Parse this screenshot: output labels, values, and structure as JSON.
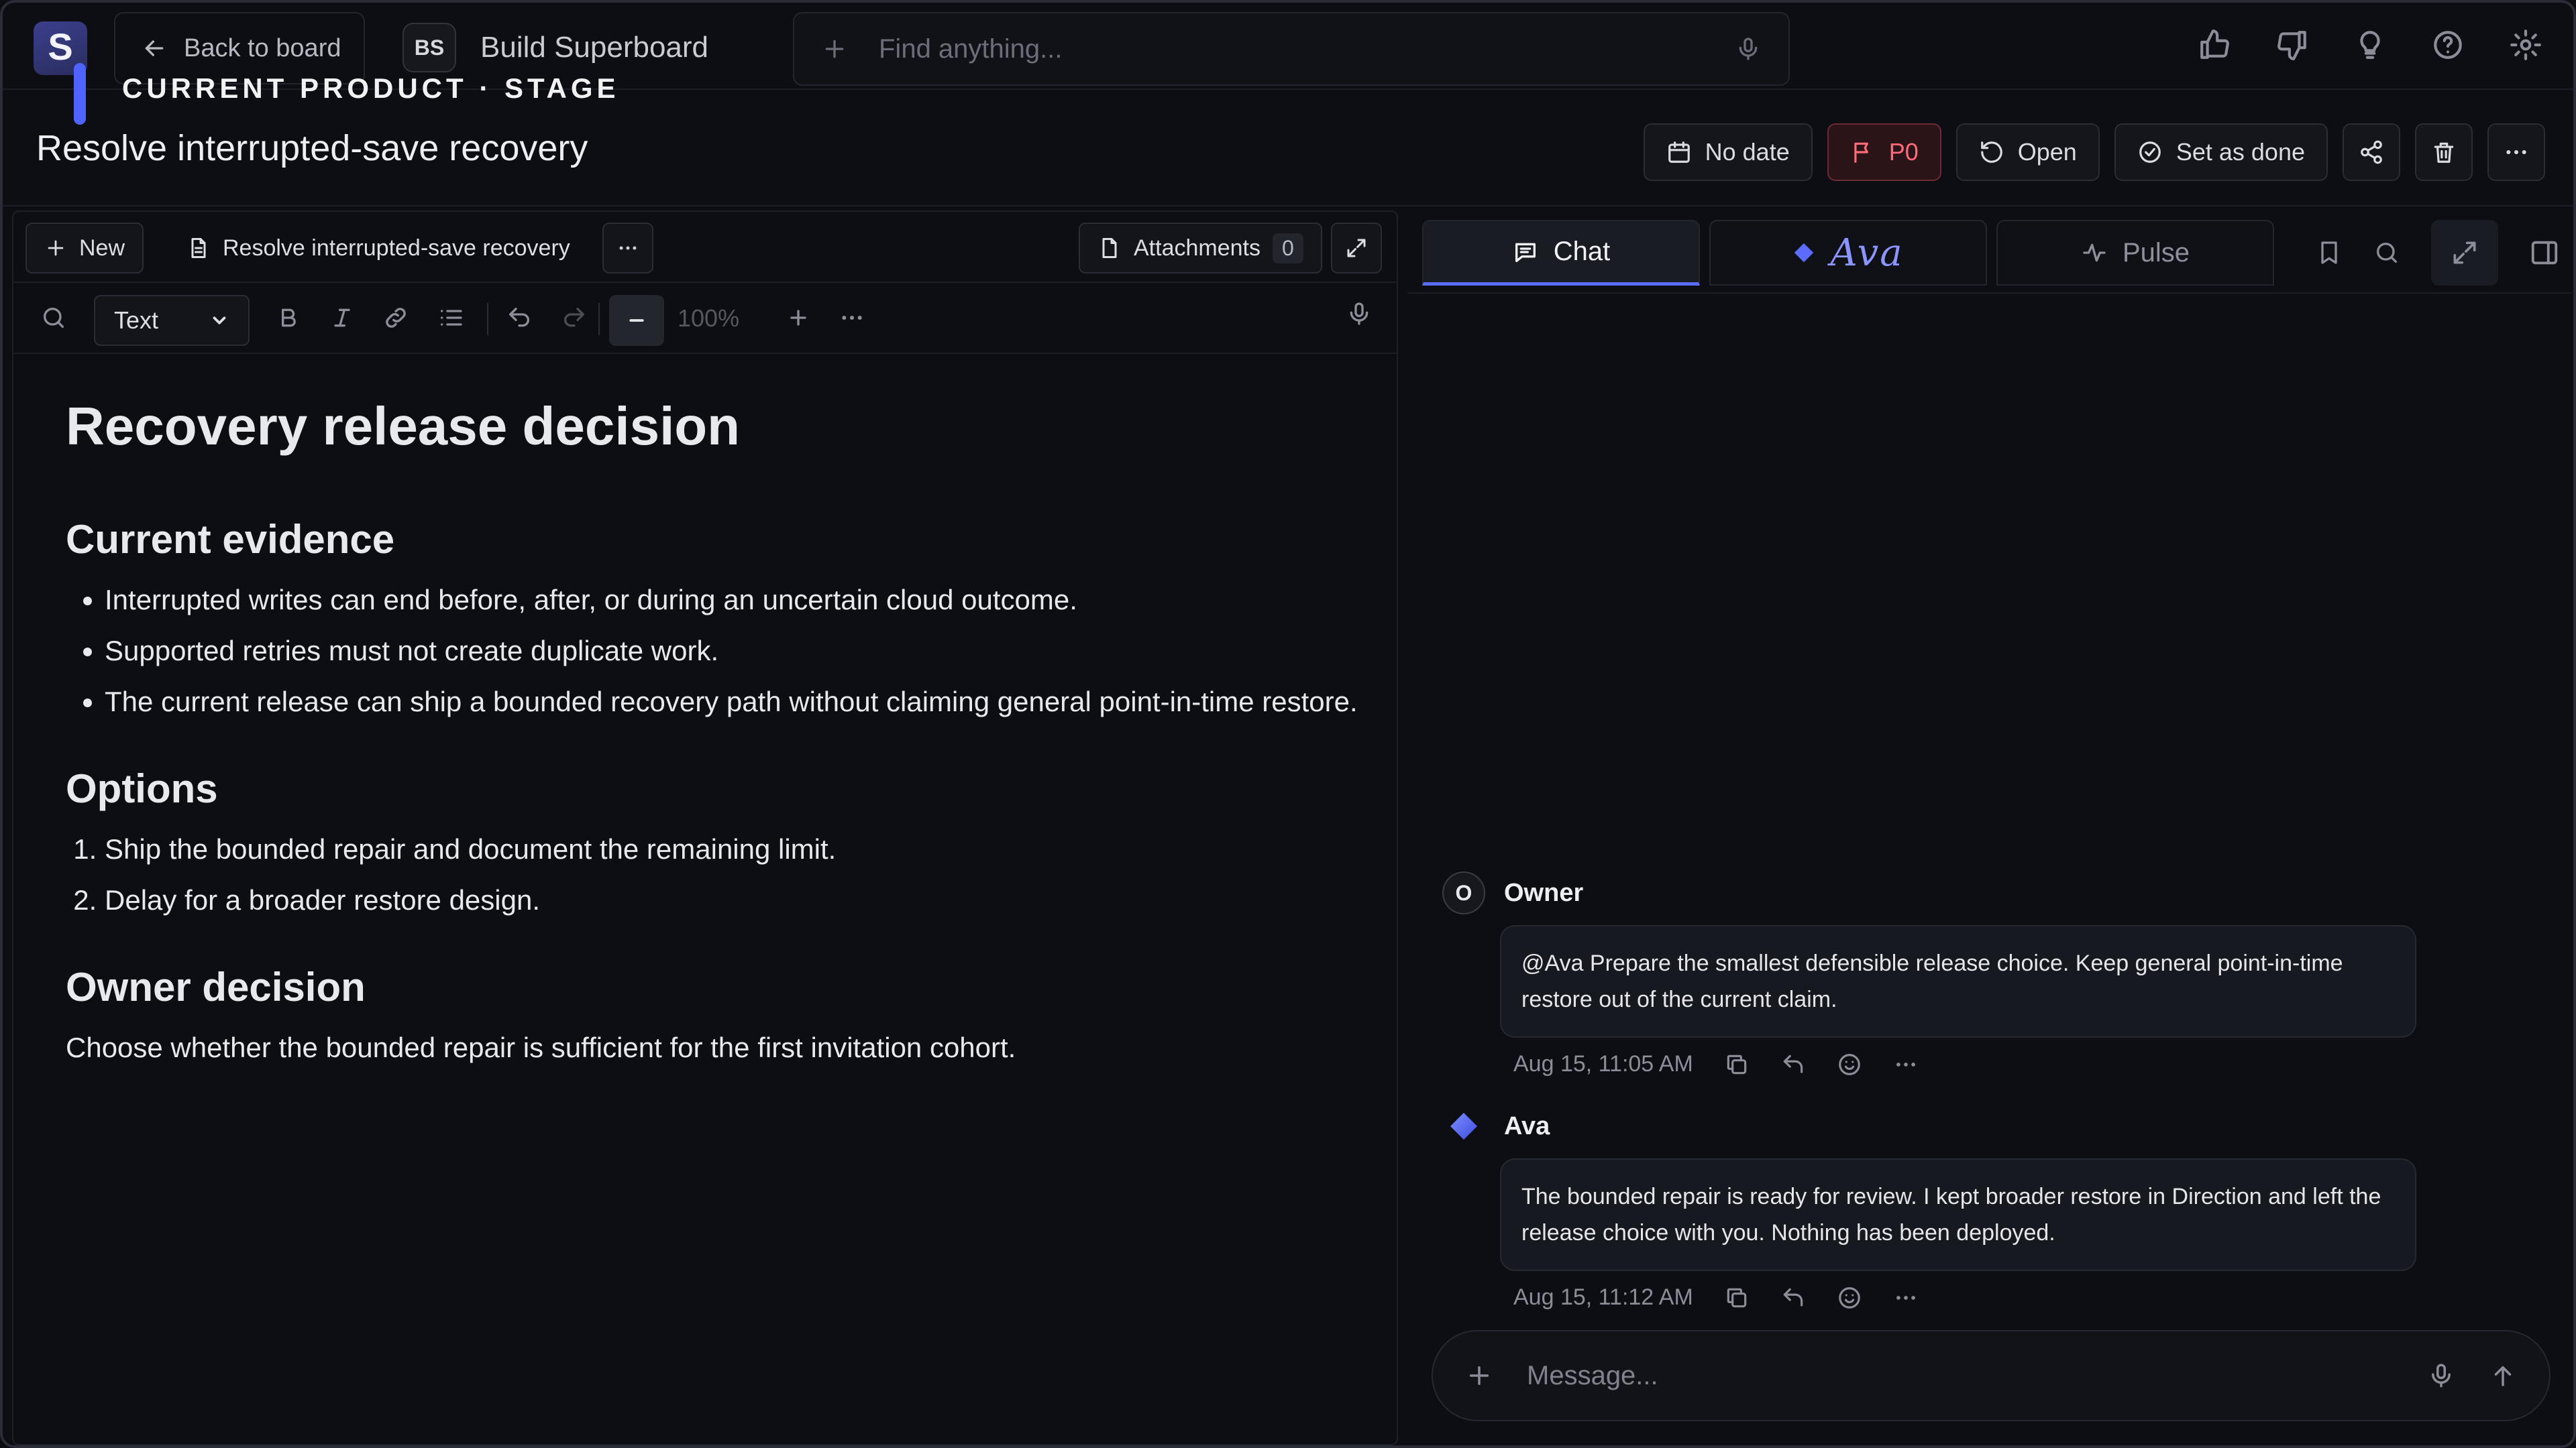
{
  "app": {
    "logo_letter": "S",
    "back_label": "Back to board",
    "project_initials": "BS",
    "project_name": "Build Superboard",
    "stage_label": "CURRENT PRODUCT · STAGE",
    "search_placeholder": "Find anything..."
  },
  "task": {
    "title": "Resolve interrupted-save recovery",
    "date_label": "No date",
    "priority_label": "P0",
    "status_label": "Open",
    "done_label": "Set as done"
  },
  "editor": {
    "new_label": "New",
    "doc_tab_label": "Resolve interrupted-save recovery",
    "attachments_label": "Attachments",
    "attachments_count": "0",
    "style_value": "Text",
    "zoom_value": "100%"
  },
  "document": {
    "heading": "Recovery release decision",
    "evidence_heading": "Current evidence",
    "evidence_items": [
      "Interrupted writes can end before, after, or during an uncertain cloud outcome.",
      "Supported retries must not create duplicate work.",
      "The current release can ship a bounded recovery path without claiming general point-in-time restore."
    ],
    "options_heading": "Options",
    "options_items": [
      "Ship the bounded repair and document the remaining limit.",
      "Delay for a broader restore design."
    ],
    "decision_heading": "Owner decision",
    "decision_text": "Choose whether the bounded repair is sufficient for the first invitation cohort."
  },
  "chat": {
    "tabs": [
      "Chat",
      "Ava",
      "Pulse"
    ],
    "messages": [
      {
        "author": "Owner",
        "initial": "O",
        "text": "@Ava Prepare the smallest defensible release choice. Keep general point-in-time restore out of the current claim.",
        "time": "Aug 15, 11:05 AM"
      },
      {
        "author": "Ava",
        "initial": "",
        "text": "The bounded repair is ready for review. I kept broader restore in Direction and left the release choice with you. Nothing has been deployed.",
        "time": "Aug 15, 11:12 AM"
      }
    ],
    "composer_placeholder": "Message..."
  },
  "colors": {
    "accent": "#5b6cff",
    "priority": "#ff6b78",
    "background": "#0d0e13"
  }
}
